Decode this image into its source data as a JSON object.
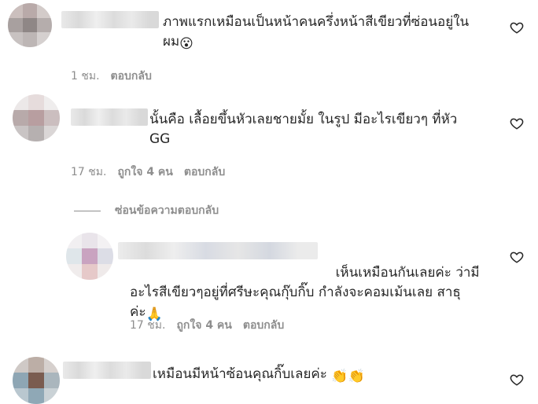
{
  "comments": [
    {
      "text": "ภาพแรกเหมือนเป็นหน้าคนครึ่งหน้าสีเขียวที่ซ่อนอยู่ใน\nผม",
      "emoji": "😮",
      "time": "1 ชม.",
      "reply_label": "ตอบกลับ"
    },
    {
      "text": "นั้นคือ เลื้อยขึ้นหัวเลยชายมั้ย ในรูป มีอะไรเขียวๆ ที่หัว\nGG",
      "time": "17 ชม.",
      "likes": "ถูกใจ 4 คน",
      "reply_label": "ตอบกลับ"
    },
    {
      "text": "เห็นเหมือนกันเลยค่ะ ว่ามี\nอะไรสีเขียวๆอยู่ที่ศรีษะคุณกุ๊บกิ๊บ กำลังจะคอมเม้นเลย สาธุ\nค่ะ",
      "emoji": "🙏",
      "time": "17 ชม.",
      "likes": "ถูกใจ 4 คน",
      "reply_label": "ตอบกลับ"
    },
    {
      "text": "เหมือนมีหน้าซ้อนคุณกิ๊บเลยค่ะ",
      "emoji": "👏👏"
    }
  ],
  "hide_replies_label": "ซ่อนข้อความตอบกลับ",
  "icons": {
    "like": "heart-outline-icon"
  },
  "colors": {
    "text": "#262626",
    "meta": "#8e8e8e",
    "background": "#ffffff"
  }
}
